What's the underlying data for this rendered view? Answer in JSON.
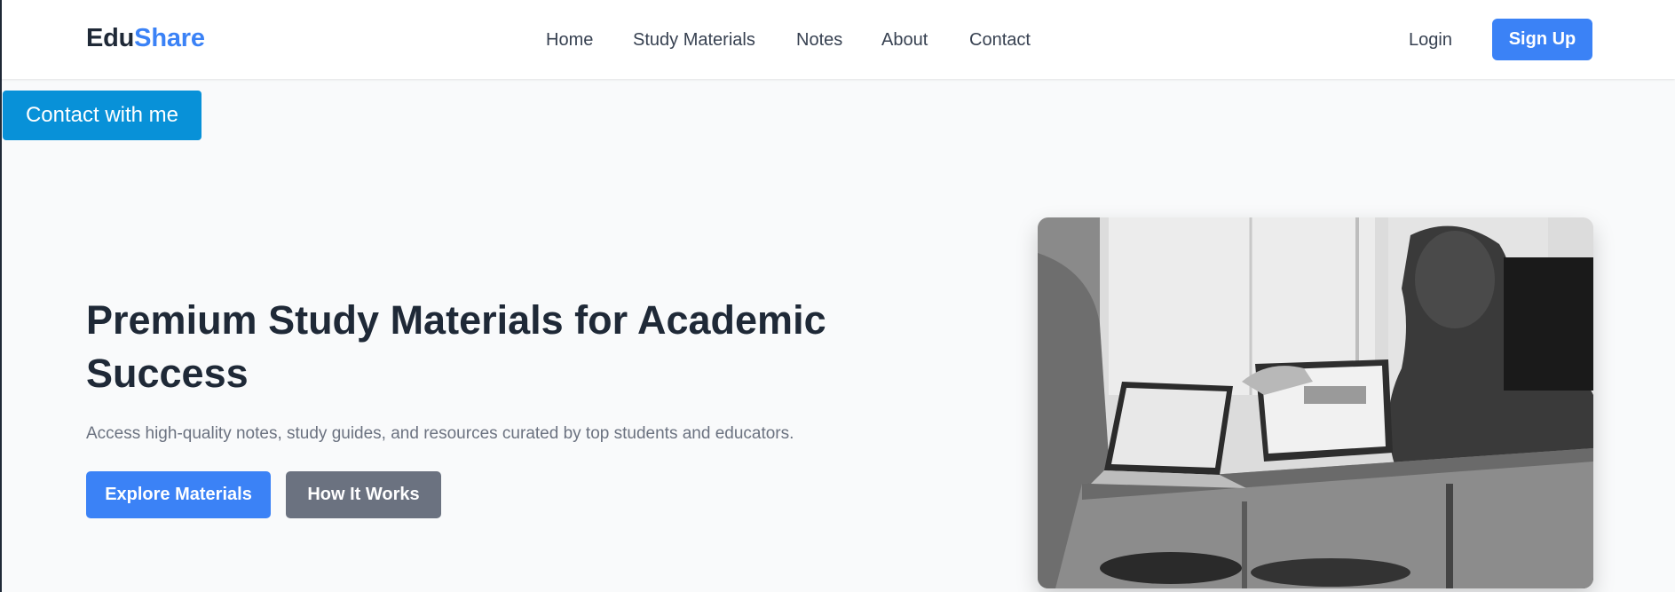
{
  "brand": {
    "part1": "Edu",
    "part2": "Share"
  },
  "nav": {
    "links": [
      "Home",
      "Study Materials",
      "Notes",
      "About",
      "Contact"
    ],
    "login": "Login",
    "signup": "Sign Up"
  },
  "floating": {
    "contact_label": "Contact with me"
  },
  "hero": {
    "title": "Premium Study Materials for Academic Success",
    "subtitle": "Access high-quality notes, study guides, and resources curated by top students and educators.",
    "primary_button": "Explore Materials",
    "secondary_button": "How It Works",
    "image_alt": "Students working on laptops at a table"
  },
  "colors": {
    "brand_accent": "#3b82f6",
    "contact_button": "#0891d8",
    "secondary_button": "#6b7280",
    "heading": "#1f2937",
    "page_background": "#f9fafb"
  }
}
